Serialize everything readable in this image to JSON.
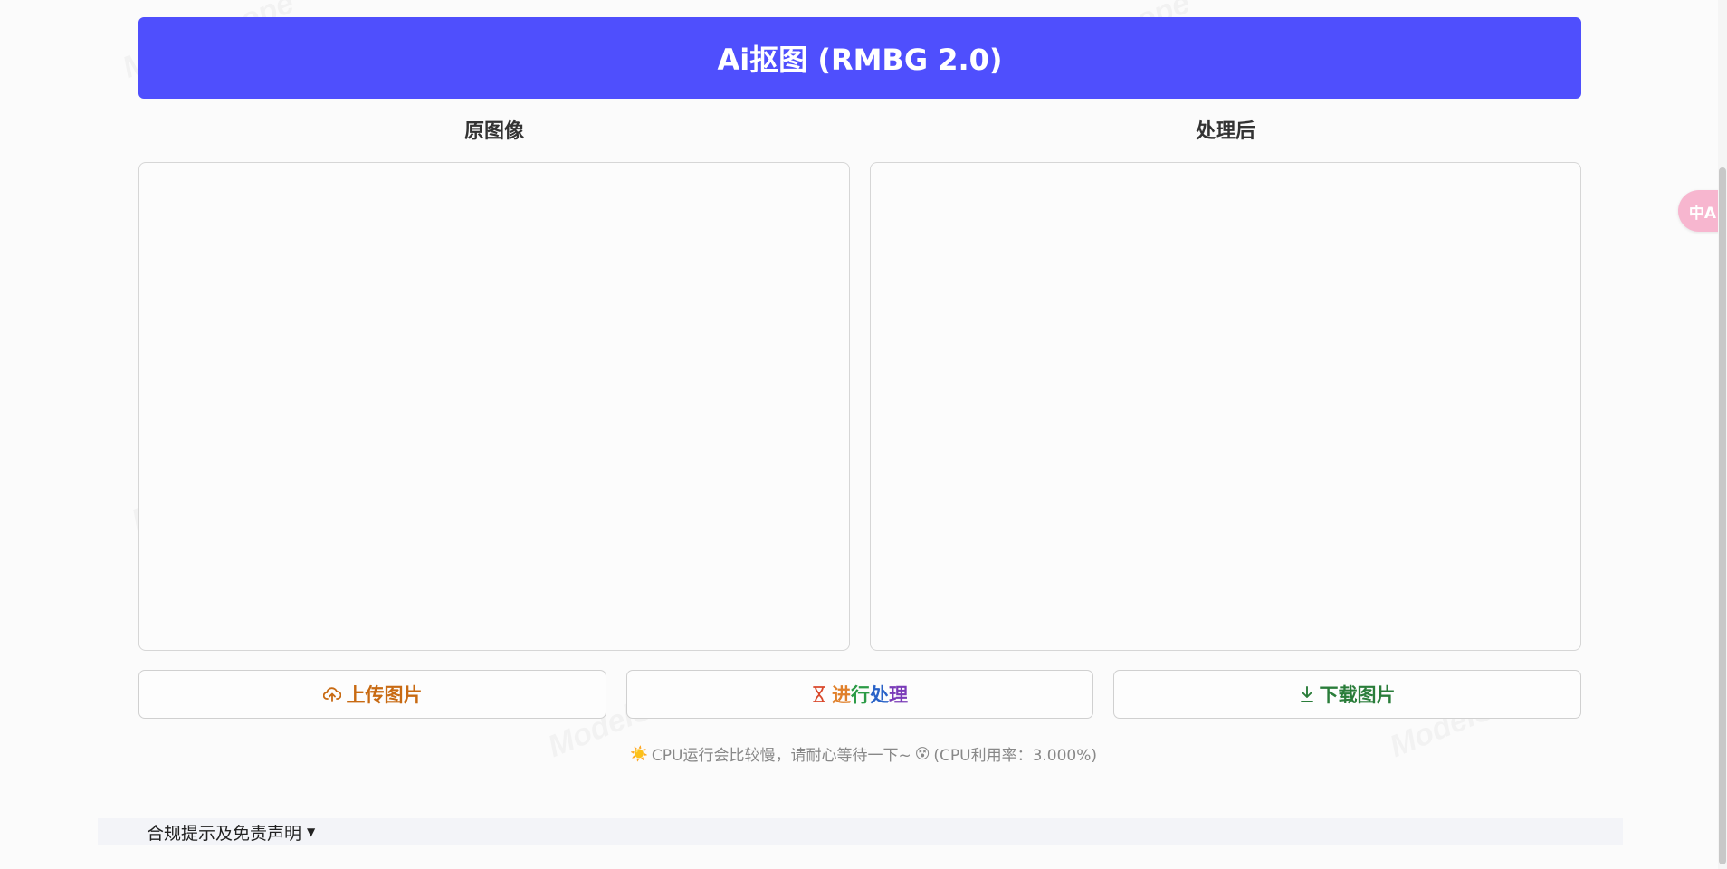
{
  "header": {
    "title": "Ai抠图 (RMBG 2.0)",
    "color": "#4f4ffd"
  },
  "panels": {
    "original_label": "原图像",
    "processed_label": "处理后"
  },
  "buttons": {
    "upload": {
      "label": "上传图片",
      "icon": "cloud-upload-icon",
      "color": "#c86a12"
    },
    "process": {
      "label_parts": [
        "进",
        "行",
        "处",
        "理"
      ],
      "icon": "hourglass-icon",
      "colors": [
        "#e0802a",
        "#2b9b46",
        "#2a63c8",
        "#7a3bb8"
      ]
    },
    "download": {
      "label": "下载图片",
      "icon": "download-icon",
      "color": "#2a7d3a"
    }
  },
  "note": {
    "sun_icon": "☀️",
    "text": "CPU运行会比较慢，请耐心等待一下~",
    "face_icon": "😵",
    "cpu_usage": "(CPU利用率：3.000%)"
  },
  "footer": {
    "label": "合规提示及免责声明",
    "toggle_icon": "▼"
  },
  "watermark": "ModelScope",
  "translate_button": {
    "label": "中A",
    "icon": "translate-icon"
  }
}
